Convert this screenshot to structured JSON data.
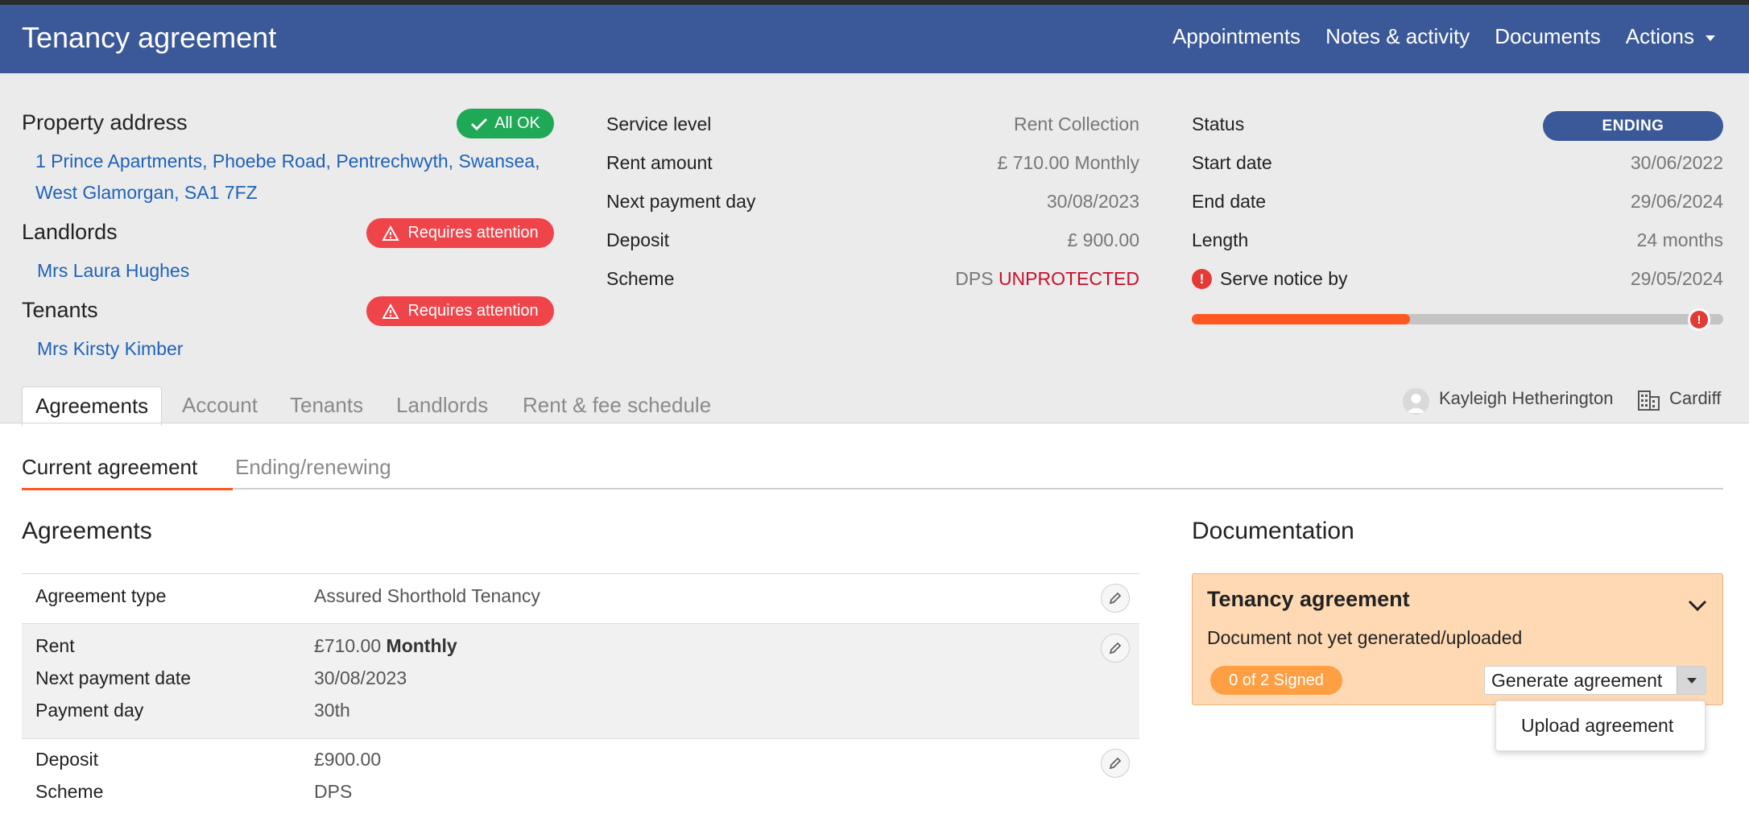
{
  "header": {
    "title": "Tenancy agreement",
    "nav": [
      "Appointments",
      "Notes & activity",
      "Documents",
      "Actions"
    ]
  },
  "property": {
    "label": "Property address",
    "ok_badge": "All OK",
    "address_line1": "1 Prince Apartments, Phoebe Road, Pentrechwyth, Swansea,",
    "address_line2": "West Glamorgan, SA1 7FZ",
    "landlords_label": "Landlords",
    "landlords_badge": "Requires attention",
    "landlord_name": "Mrs Laura Hughes",
    "tenants_label": "Tenants",
    "tenants_badge": "Requires attention",
    "tenant_name": "Mrs Kirsty Kimber"
  },
  "service": {
    "service_level_label": "Service level",
    "service_level_value": "Rent Collection",
    "rent_label": "Rent amount",
    "rent_value": "£ 710.00 Monthly",
    "next_payment_label": "Next payment day",
    "next_payment_value": "30/08/2023",
    "deposit_label": "Deposit",
    "deposit_value": "£ 900.00",
    "scheme_label": "Scheme",
    "scheme_value": "DPS",
    "scheme_status": "UNPROTECTED"
  },
  "status": {
    "status_label": "Status",
    "status_value": "ENDING",
    "start_label": "Start date",
    "start_value": "30/06/2022",
    "end_label": "End date",
    "end_value": "29/06/2024",
    "length_label": "Length",
    "length_value": "24 months",
    "notice_label": "Serve notice by",
    "notice_value": "29/05/2024",
    "progress_fraction": 0.41
  },
  "tabs": [
    "Agreements",
    "Account",
    "Tenants",
    "Landlords",
    "Rent & fee schedule"
  ],
  "assignee": {
    "user": "Kayleigh Hetherington",
    "office": "Cardiff"
  },
  "subtabs": [
    "Current agreement",
    "Ending/renewing"
  ],
  "agreements": {
    "title": "Agreements",
    "type_label": "Agreement type",
    "type_value": "Assured Shorthold Tenancy",
    "rent_label": "Rent",
    "rent_amount": "£710.00",
    "rent_freq": "Monthly",
    "next_payment_label": "Next payment date",
    "next_payment_value": "30/08/2023",
    "payment_day_label": "Payment day",
    "payment_day_value": "30th",
    "deposit_label": "Deposit",
    "deposit_value": "£900.00",
    "scheme_label": "Scheme",
    "scheme_value": "DPS"
  },
  "documentation": {
    "title": "Documentation",
    "card_title": "Tenancy agreement",
    "card_status": "Document not yet generated/uploaded",
    "signed_badge": "0  of  2  Signed",
    "generate_label": "Generate agreement",
    "dropdown_item": "Upload agreement"
  },
  "colors": {
    "header_blue": "#3b5998",
    "ok_green": "#1fa855",
    "warn_red": "#f0444b",
    "progress_orange": "#ff5722",
    "doc_card_bg": "#ffd9b3"
  }
}
